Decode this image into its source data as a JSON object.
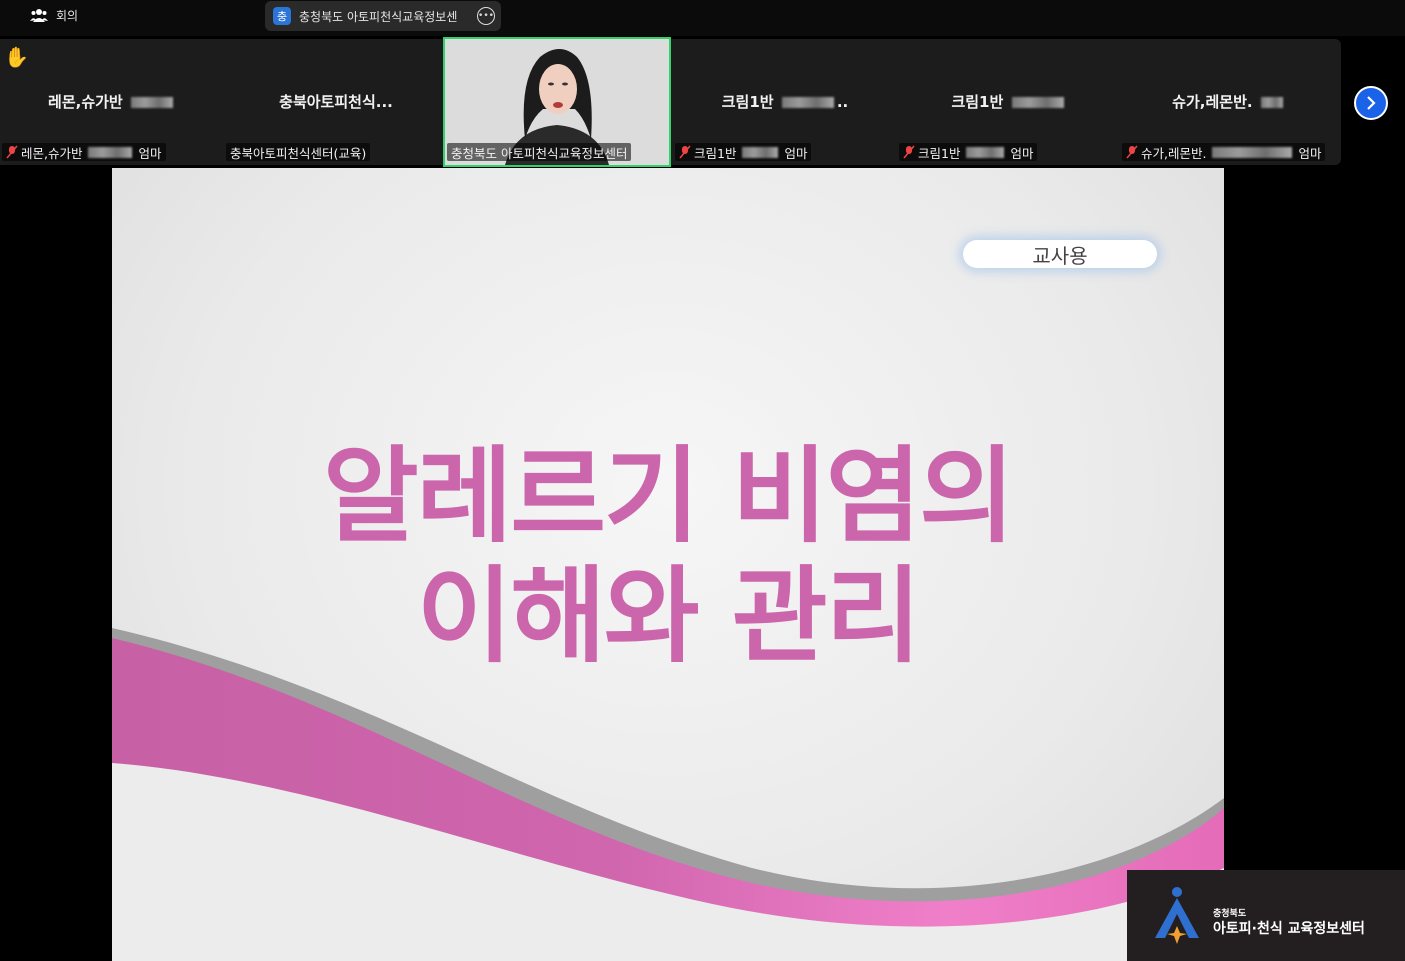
{
  "topbar": {
    "meeting_label": "회의",
    "share_badge": "충",
    "share_title": "충청북도 아토피천식교육정보센"
  },
  "participants": [
    {
      "display_name": "레몬,슈가반",
      "label_prefix": "레몬,슈가반",
      "label_suffix": "엄마"
    },
    {
      "display_name": "충북아토피천식...",
      "label_prefix": "충북아토피천식센터(교육)",
      "label_suffix": ""
    },
    {
      "display_name": "",
      "label_prefix": "충청북도 아토피천식교육정보센터",
      "label_suffix": ""
    },
    {
      "display_name": "크림1반",
      "label_prefix": "크림1반",
      "label_suffix": "엄마"
    },
    {
      "display_name": "크림1반",
      "label_prefix": "크림1반",
      "label_suffix": "엄마"
    },
    {
      "display_name": "슈가,레몬반.",
      "label_prefix": "슈가,레몬반.",
      "label_suffix": "엄마"
    }
  ],
  "slide": {
    "badge": "교사용",
    "title_line1": "알레르기 비염의",
    "title_line2": "이해와 관리",
    "colors": {
      "title": "#cc66ac",
      "wave": "#d264ae"
    }
  },
  "logo": {
    "small": "충청북도",
    "big": "아토피·천식 교육정보센터"
  },
  "colors": {
    "active_speaker": "#2fd36a",
    "accent": "#1a63e8"
  }
}
